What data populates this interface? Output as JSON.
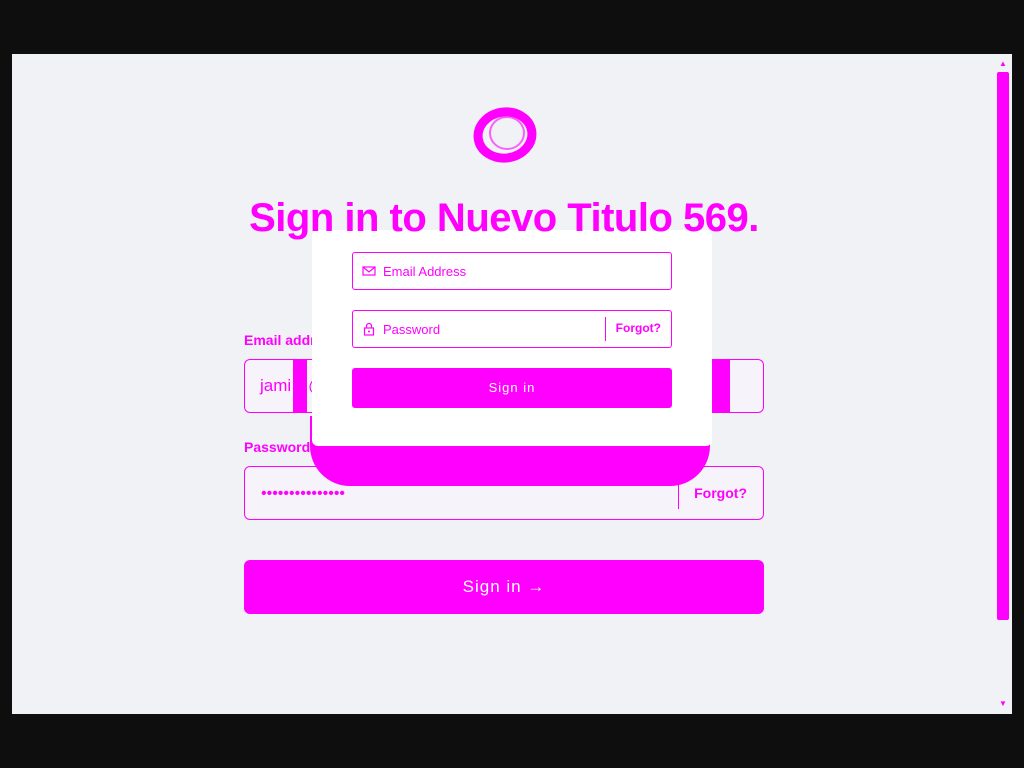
{
  "page": {
    "heading": "Sign in to Nuevo Titulo 569."
  },
  "background_form": {
    "email_label": "Email address",
    "email_value": "jami…@exa",
    "password_label": "Password",
    "password_value": "•••••••••••••••",
    "forgot_label": "Forgot?",
    "submit_label": "Sign in →"
  },
  "card_form": {
    "email_placeholder": "Email Address",
    "password_placeholder": "Password",
    "forgot_label": "Forgot?",
    "submit_label": "Sign in"
  },
  "icons": {
    "logo": "logo-ring-icon",
    "email": "mail-icon",
    "password": "lock-icon",
    "scroll_up": "triangle-up-icon",
    "scroll_down": "triangle-down-icon"
  },
  "colors": {
    "accent": "#ff00ff",
    "page_bg": "#f1f2f6",
    "frame_bg": "#0e0e0f",
    "card_bg": "#ffffff"
  }
}
